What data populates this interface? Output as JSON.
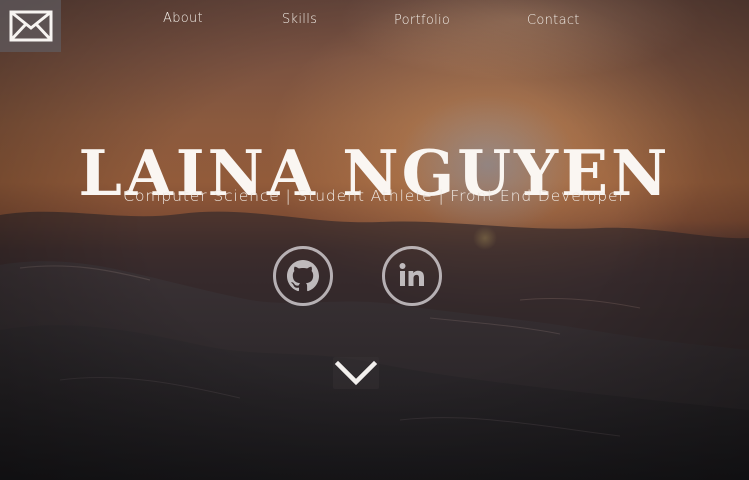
{
  "nav": {
    "items": [
      {
        "label": "About"
      },
      {
        "label": "Skills"
      },
      {
        "label": "Portfolio"
      },
      {
        "label": "Contact"
      }
    ]
  },
  "hero": {
    "name": "LAINA NGUYEN",
    "tagline": "Computer Science | Student Athlete | Front End Developer"
  },
  "icons": {
    "mail": "envelope-icon",
    "github": "github-octocat-icon",
    "linkedin": "linkedin-icon",
    "scroll": "chevron-down-icon"
  },
  "colors": {
    "text": "#f4efea",
    "icon_ring": "#e1dee1",
    "mail_box": "#5f5c60"
  }
}
